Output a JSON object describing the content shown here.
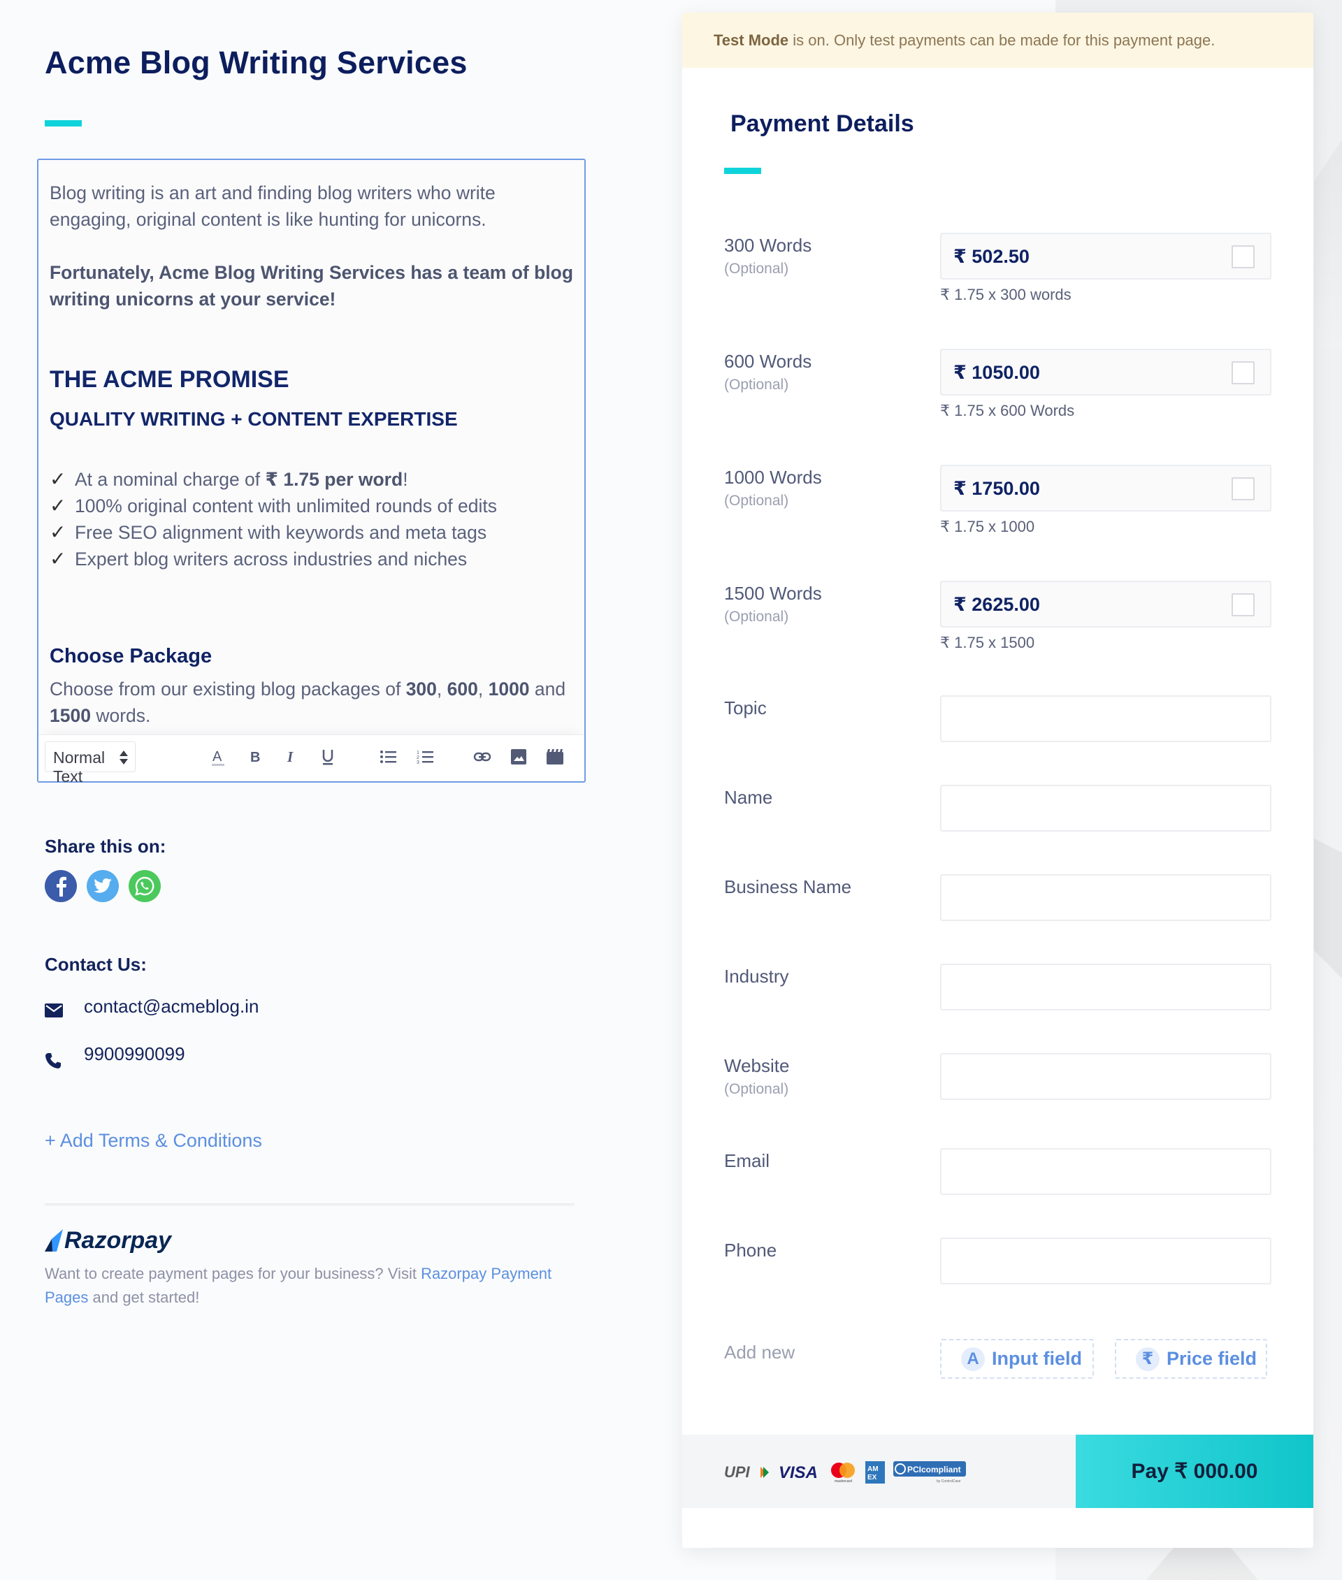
{
  "left": {
    "title": "Acme Blog Writing Services",
    "editor": {
      "intro": "Blog writing is an art and finding blog writers who write engaging, original content is like hunting for unicorns.",
      "highlight": "Fortunately, Acme Blog Writing Services has a team of blog writing unicorns at your service!",
      "promise_heading": "THE ACME PROMISE",
      "promise_subheading": "QUALITY WRITING + CONTENT EXPERTISE",
      "checklist": [
        {
          "prefix": "At a nominal charge of ",
          "bold": "₹ 1.75 per word",
          "suffix": "!"
        },
        {
          "prefix": "100% original content with unlimited rounds of edits",
          "bold": "",
          "suffix": ""
        },
        {
          "prefix": "Free SEO alignment with keywords and meta tags",
          "bold": "",
          "suffix": ""
        },
        {
          "prefix": "Expert blog writers across industries and niches",
          "bold": "",
          "suffix": ""
        }
      ],
      "check_glyph": "✓",
      "package_heading": "Choose Package",
      "package_text": {
        "p1": "Choose from our existing blog packages of ",
        "b1": "300",
        "s1": ", ",
        "b2": "600",
        "s2": ", ",
        "b3": "1000",
        "p2": " and ",
        "b4": "1500",
        "p3": " words."
      },
      "toolbar": {
        "text_style": "Normal Text",
        "buttons": [
          "text-color",
          "bold",
          "italic",
          "underline",
          "bulleted-list",
          "numbered-list",
          "link",
          "image",
          "video"
        ]
      }
    },
    "share": {
      "label": "Share this on:",
      "networks": [
        "facebook",
        "twitter",
        "whatsapp"
      ],
      "colors": {
        "facebook": "#3b5bab",
        "twitter": "#55acee",
        "whatsapp": "#4cc95d"
      }
    },
    "contact": {
      "label": "Contact Us:",
      "email": "contact@acmeblog.in",
      "phone": "9900990099"
    },
    "add_terms": "+ Add Terms & Conditions",
    "footer": {
      "brand": "Razorpay",
      "text": "Want to create payment pages for your business? Visit ",
      "link": "Razorpay Payment Pages",
      "text_after": " and get started!"
    }
  },
  "card": {
    "test_banner": {
      "bold": "Test Mode",
      "text": " is on. Only test payments can be made for this payment page."
    },
    "title": "Payment Details",
    "price_fields": [
      {
        "label": "300 Words",
        "optional": "(Optional)",
        "amount": "₹ 502.50",
        "note": "₹ 1.75 x 300 words",
        "checked": false
      },
      {
        "label": "600 Words",
        "optional": "(Optional)",
        "amount": "₹ 1050.00",
        "note": "₹ 1.75 x 600 Words",
        "checked": false
      },
      {
        "label": "1000 Words",
        "optional": "(Optional)",
        "amount": "₹ 1750.00",
        "note": "₹ 1.75 x 1000",
        "checked": false
      },
      {
        "label": "1500 Words",
        "optional": "(Optional)",
        "amount": "₹ 2625.00",
        "note": "₹ 1.75 x 1500",
        "checked": false
      }
    ],
    "input_fields": [
      {
        "label": "Topic",
        "optional": "",
        "value": ""
      },
      {
        "label": "Name",
        "optional": "",
        "value": ""
      },
      {
        "label": "Business Name",
        "optional": "",
        "value": ""
      },
      {
        "label": "Industry",
        "optional": "",
        "value": ""
      },
      {
        "label": "Website",
        "optional": "(Optional)",
        "value": ""
      },
      {
        "label": "Email",
        "optional": "",
        "value": ""
      },
      {
        "label": "Phone",
        "optional": "",
        "value": ""
      }
    ],
    "add_new": {
      "label": "Add new",
      "input_field": {
        "icon": "A",
        "label": "Input field"
      },
      "price_field": {
        "icon": "₹",
        "label": "Price field"
      }
    },
    "payment_methods": [
      "UPI",
      "VISA",
      "mastercard",
      "AMEX",
      "PCI compliant"
    ],
    "pay_button": "Pay  ₹ 000.00",
    "colors": {
      "accent_teal": "#0fd3db",
      "navy": "#0d1e5e",
      "link_blue": "#5b8fe0",
      "banner_bg": "#fdf6e3"
    }
  }
}
